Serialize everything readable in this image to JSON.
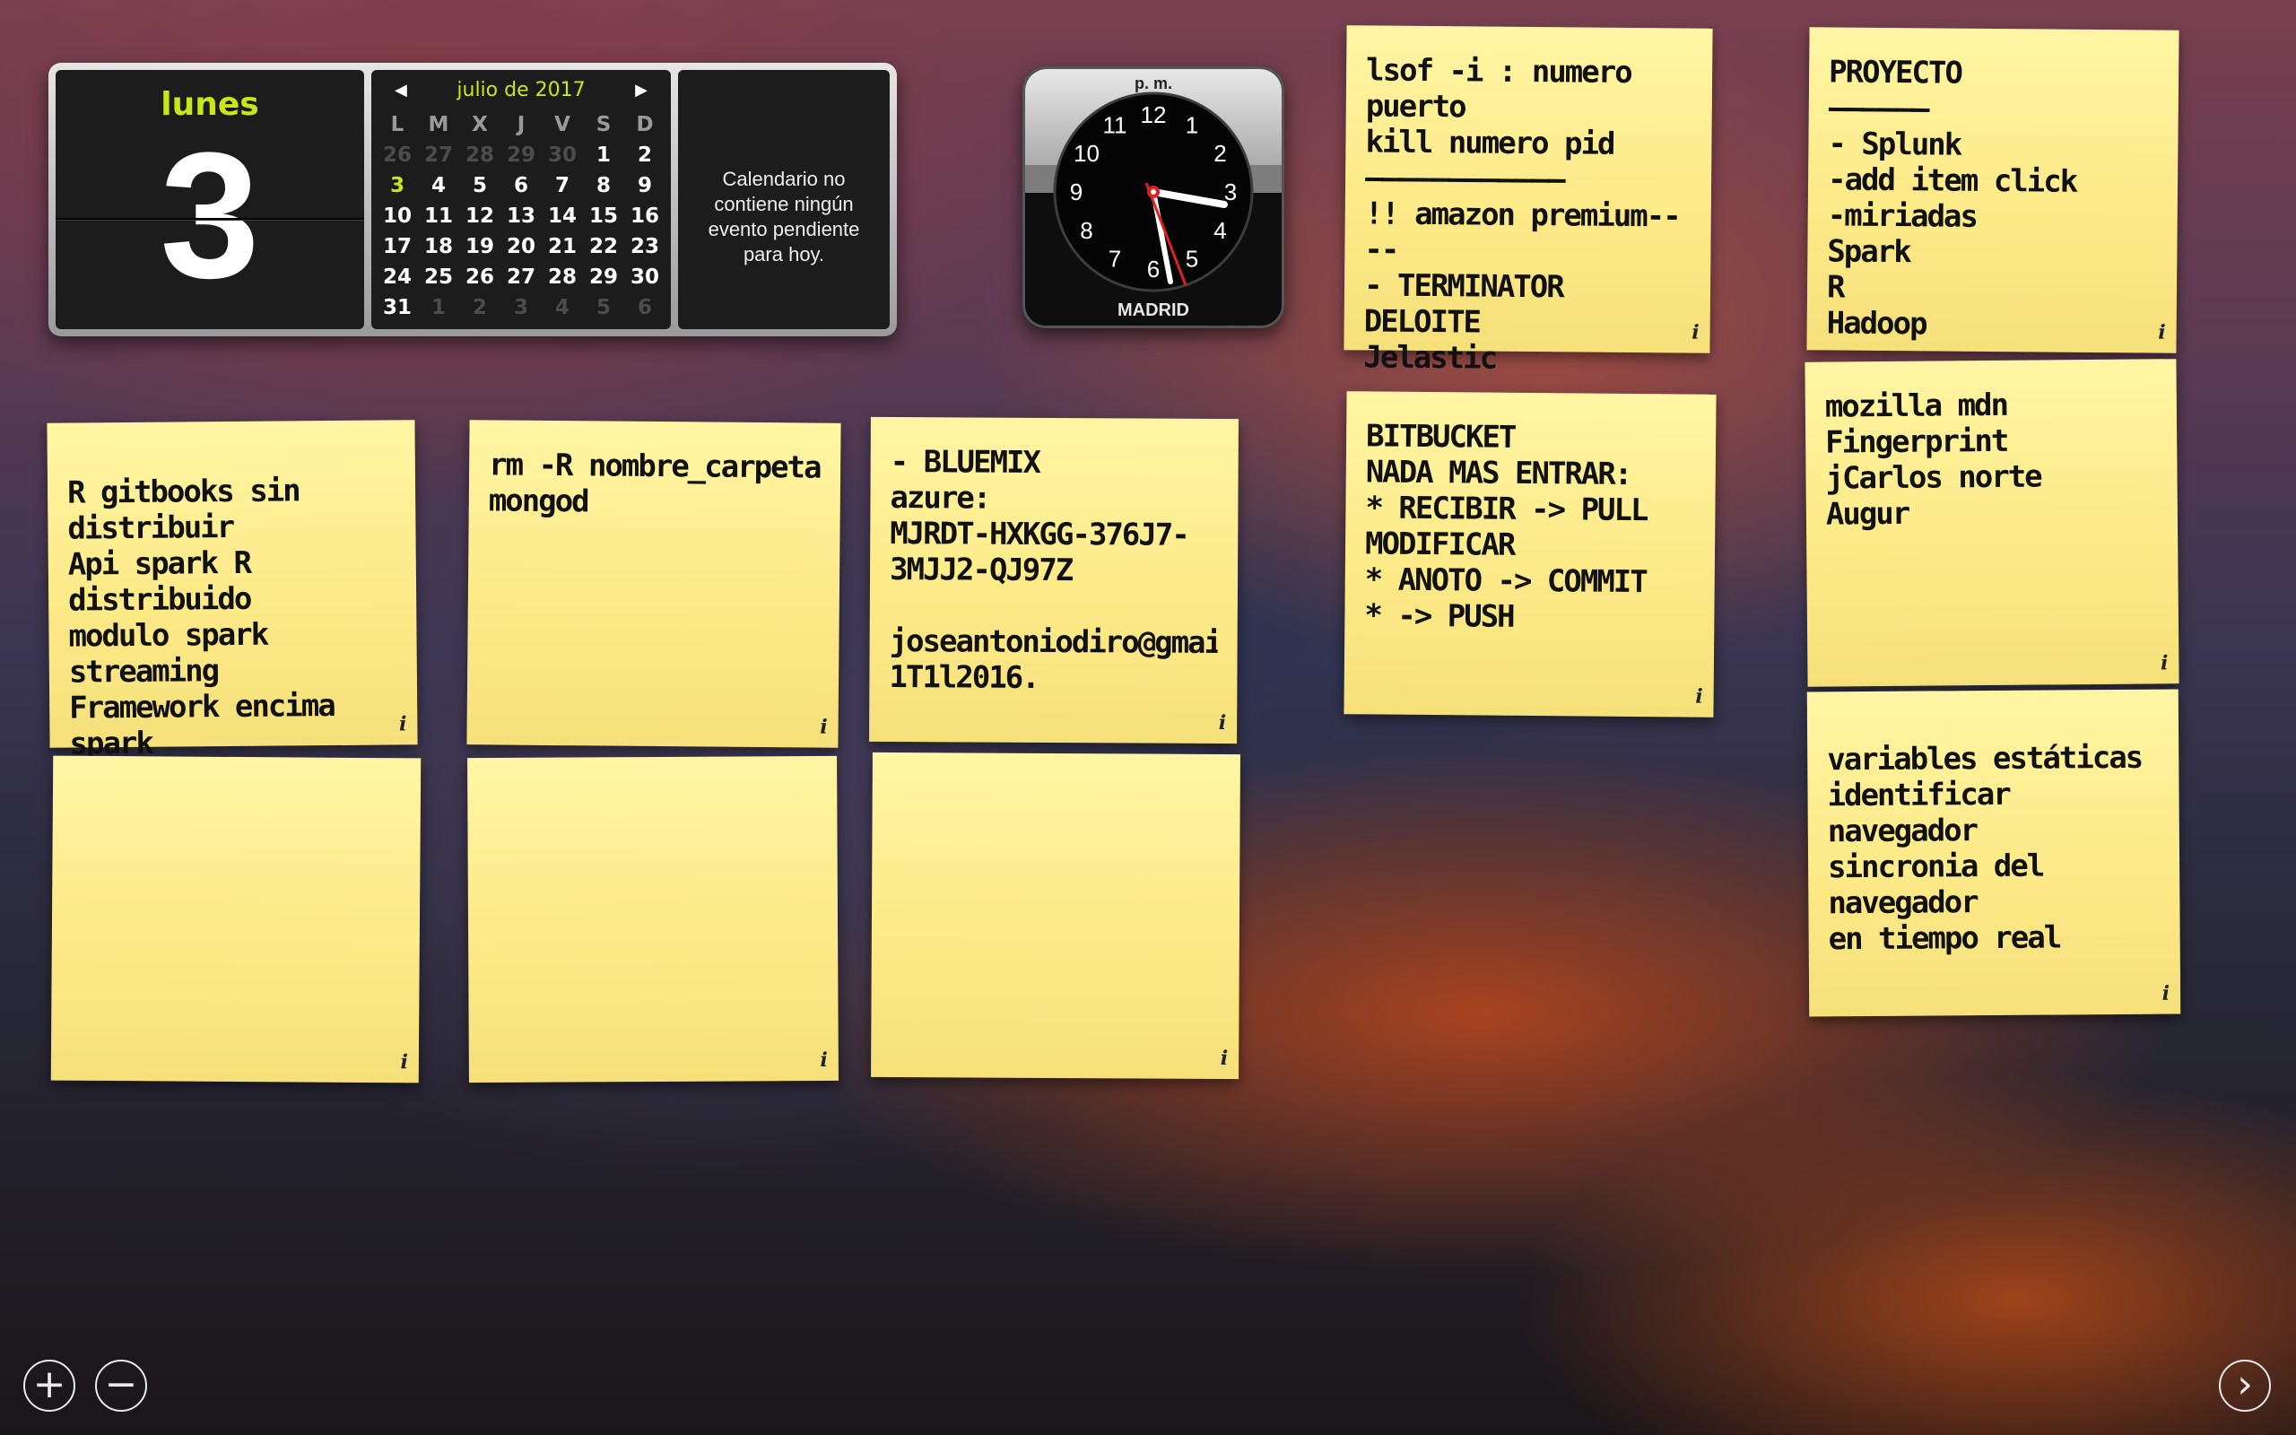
{
  "calendar": {
    "day_name": "lunes",
    "day_number": "3",
    "month_title": "julio de 2017",
    "prev_icon": "◀",
    "next_icon": "▶",
    "weekdays": [
      "L",
      "M",
      "X",
      "J",
      "V",
      "S",
      "D"
    ],
    "weeks": [
      [
        "26",
        "27",
        "28",
        "29",
        "30",
        "1",
        "2"
      ],
      [
        "3",
        "4",
        "5",
        "6",
        "7",
        "8",
        "9"
      ],
      [
        "10",
        "11",
        "12",
        "13",
        "14",
        "15",
        "16"
      ],
      [
        "17",
        "18",
        "19",
        "20",
        "21",
        "22",
        "23"
      ],
      [
        "24",
        "25",
        "26",
        "27",
        "28",
        "29",
        "30"
      ],
      [
        "31",
        "1",
        "2",
        "3",
        "4",
        "5",
        "6"
      ]
    ],
    "events_text": "Calendario no contiene ningún evento pendiente para hoy.",
    "accent_color": "#c8e61a"
  },
  "clock": {
    "period": "p. m.",
    "city": "MADRID",
    "numbers": [
      "12",
      "1",
      "2",
      "3",
      "4",
      "5",
      "6",
      "7",
      "8",
      "9",
      "10",
      "11"
    ]
  },
  "notes": [
    {
      "text": "lsof -i : numero puerto\nkill numero pid\n————————————\n!! amazon premium----\n- TERMINATOR\nDELOITE\nJelastic",
      "info": "i"
    },
    {
      "text": "PROYECTO\n——————\n- Splunk\n-add item click\n-miriadas\nSpark\nR\nHadoop",
      "info": "i"
    },
    {
      "text": "BITBUCKET\nNADA MAS ENTRAR:\n* RECIBIR -> PULL\nMODIFICAR\n* ANOTO -> COMMIT\n* -> PUSH",
      "info": "i"
    },
    {
      "text": "mozilla mdn\nFingerprint\njCarlos norte\nAugur",
      "info": "i"
    },
    {
      "text": "R gitbooks sin distribuir\nApi spark R distribuido\nmodulo spark streaming\nFramework encima\nspark",
      "info": "i"
    },
    {
      "text": "rm -R nombre_carpeta\nmongod",
      "info": "i"
    },
    {
      "text": "- BLUEMIX\nazure:\nMJRDT-HXKGG-376J7-\n3MJJ2-QJ97Z\n\njoseantoniodiro@gmail.co\n1T1l2016.",
      "info": "i"
    },
    {
      "text": "variables estáticas\nidentificar navegador\nsincronia del navegador\nen tiempo real",
      "info": "i"
    },
    {
      "text": "",
      "info": "i"
    },
    {
      "text": "",
      "info": "i"
    },
    {
      "text": "",
      "info": "i"
    }
  ],
  "note_color": "#fdea88",
  "controls": {
    "add_icon": "+",
    "remove_icon": "−",
    "next_icon": "›"
  }
}
